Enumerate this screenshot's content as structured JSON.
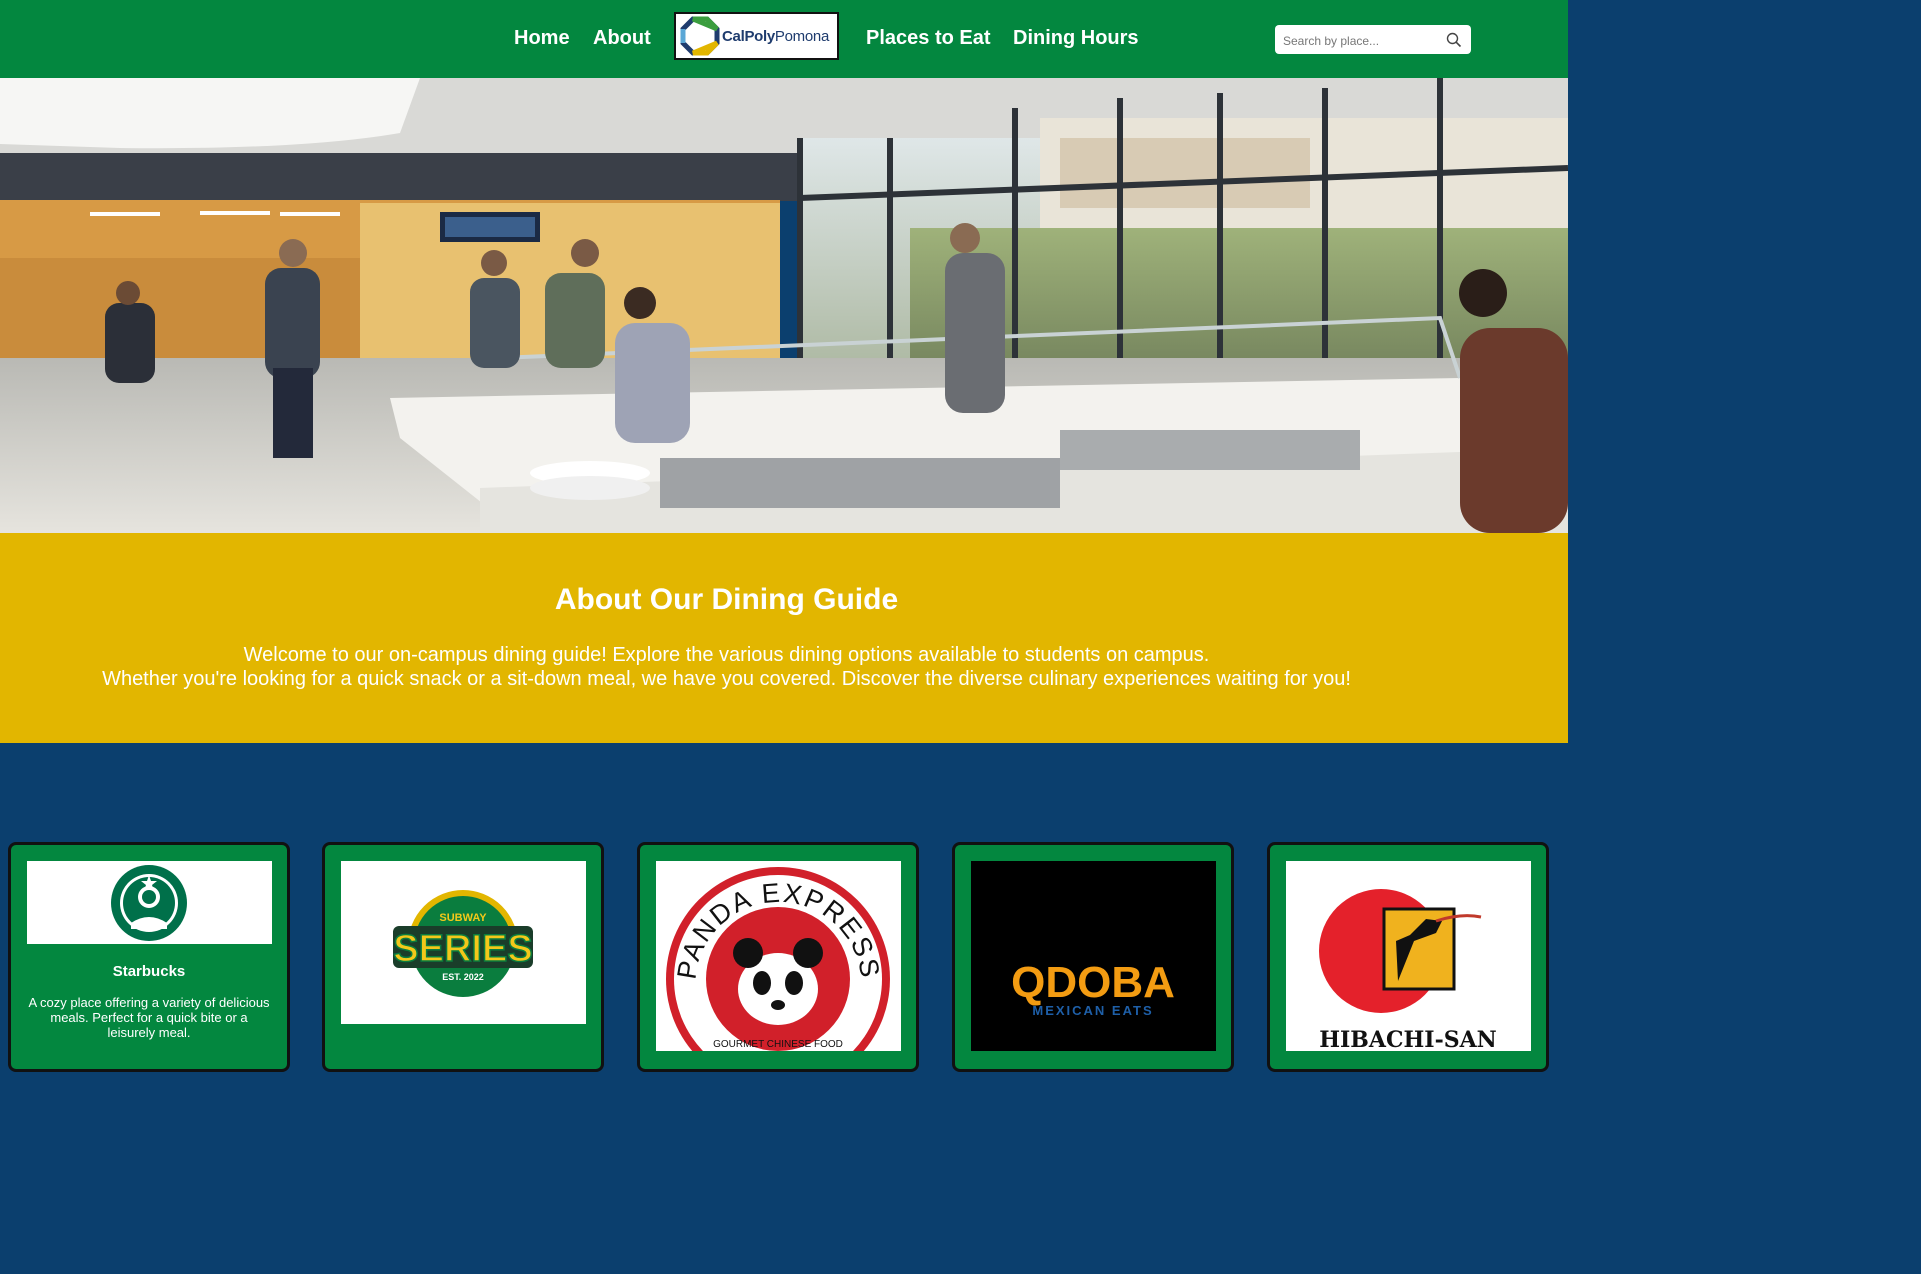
{
  "nav": {
    "links": [
      "Home",
      "About",
      "Places to Eat",
      "Dining Hours"
    ],
    "logo": {
      "part1": "CalPoly",
      "part2": "Pomona"
    },
    "search": {
      "placeholder": "Search by place..."
    }
  },
  "about": {
    "title": "About Our Dining Guide",
    "line1": "Welcome to our on-campus dining guide! Explore the various dining options available to students on campus.",
    "line2": "Whether you're looking for a quick snack or a sit-down meal, we have you covered. Discover the diverse culinary experiences waiting for you!"
  },
  "cards": [
    {
      "title": "Starbucks",
      "desc": "A cozy place offering a variety of delicious meals. Perfect for a quick bite or a leisurely meal.",
      "logo": "starbucks-logo"
    },
    {
      "title": "",
      "desc": "",
      "logo": "subway-series-logo",
      "logo_text": {
        "top": "SUBWAY",
        "main": "SERIES",
        "sub": "EST. 2022"
      }
    },
    {
      "title": "",
      "desc": "",
      "logo": "panda-express-logo",
      "logo_text": {
        "ring": "PANDA EXPRESS",
        "bottom": "GOURMET CHINESE FOOD"
      }
    },
    {
      "title": "",
      "desc": "",
      "logo": "qdoba-logo",
      "logo_text": {
        "main": "QDOBA",
        "sub": "MEXICAN EATS"
      }
    },
    {
      "title": "",
      "desc": "",
      "logo": "hibachi-san-logo",
      "logo_text": {
        "main": "HIBACHI-SAN"
      }
    }
  ],
  "colors": {
    "nav": "#03873f",
    "about": "#e2b600",
    "cards_bg": "#0b3f6e",
    "accent": "#03873f"
  }
}
